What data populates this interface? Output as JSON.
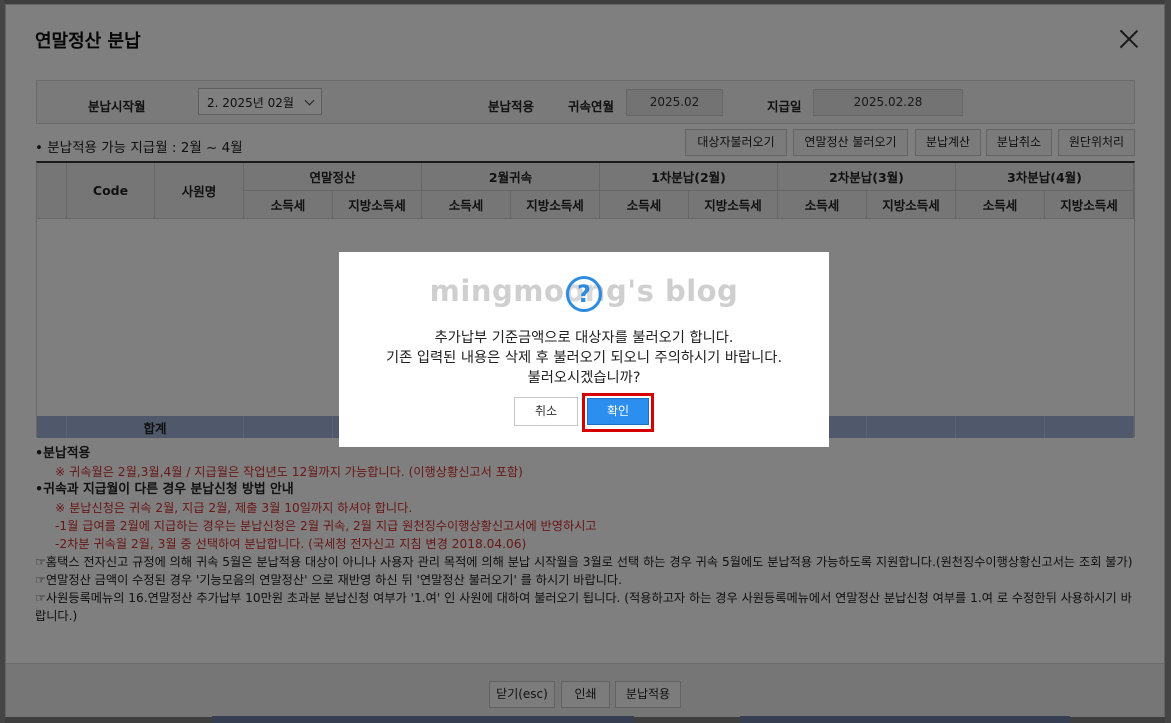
{
  "window": {
    "title": "연말정산 분납"
  },
  "filter": {
    "start_label": "분납시작월",
    "start_value": "2. 2025년 02월",
    "apply_label": "분납적용",
    "belong_label": "귀속연월",
    "belong_value": "2025.02",
    "pay_label": "지급일",
    "pay_value": "2025.02.28"
  },
  "info_line": "• 분납적용 가능 지급월 : 2월 ~ 4월",
  "toolbar": [
    "대상자불러오기",
    "연말정산 불러오기",
    "분납계산",
    "분납취소",
    "원단위처리"
  ],
  "grid": {
    "headers": {
      "code": "Code",
      "name": "사원명",
      "groups": [
        "연말정산",
        "2월귀속",
        "1차분납(2월)",
        "2차분납(3월)",
        "3차분납(4월)"
      ],
      "sub": [
        "소득세",
        "지방소득세"
      ]
    },
    "total_label": "합계"
  },
  "notes": {
    "h1": "•분납적용",
    "l1": "※ 귀속월은 2월,3월,4월 / 지급월은 작업년도 12월까지 가능합니다. (이행상황신고서 포함)",
    "h2": "•귀속과 지급월이 다른 경우 분납신청 방법 안내",
    "l2": "※ 분납신청은 귀속 2월, 지급 2월, 제출 3월 10일까지 하셔야 합니다.",
    "l3": "-1월 급여를 2월에 지급하는 경우는 분납신청은 2월 귀속, 2월 지급 원천징수이행상황신고서에 반영하시고",
    "l4": "-2차분 귀속월 2월, 3월 중 선택하여 분납합니다. (국세청 전자신고 지침 변경 2018.04.06)",
    "l5": "☞홈택스 전자신고 규정에 의해 귀속 5월은 분납적용 대상이 아니나 사용자 관리 목적에 의해 분납 시작월을 3월로 선택 하는 경우 귀속 5월에도 분납적용 가능하도록 지원합니다.(원천징수이행상황신고서는 조회 불가)",
    "l6": "☞연말정산 금액이 수정된 경우 '기능모음의 연말정산' 으로 재반영 하신 뒤 '연말정산 불러오기' 를 하시기 바랍니다.",
    "l7": "☞사원등록메뉴의 16.연말정산 추가납부 10만원 초과분 분납신청 여부가 '1.여' 인 사원에 대하여 불러오기 됩니다. (적용하고자 하는 경우 사원등록메뉴에서 연말정산 분납신청 여부를 1.여 로 수정한뒤 사용하시기 바랍니다.)"
  },
  "footer": [
    "닫기(esc)",
    "인쇄",
    "분납적용"
  ],
  "dialog": {
    "watermark": "mingmoong's blog",
    "icon": "?",
    "line1": "추가납부 기준금액으로 대상자를 불러오기 합니다.",
    "line2": "기존 입력된 내용은 삭제 후 불러오기 되오니 주의하시기 바랍니다.",
    "line3": "불러오시겠습니까?",
    "cancel": "취소",
    "confirm": "확인"
  }
}
